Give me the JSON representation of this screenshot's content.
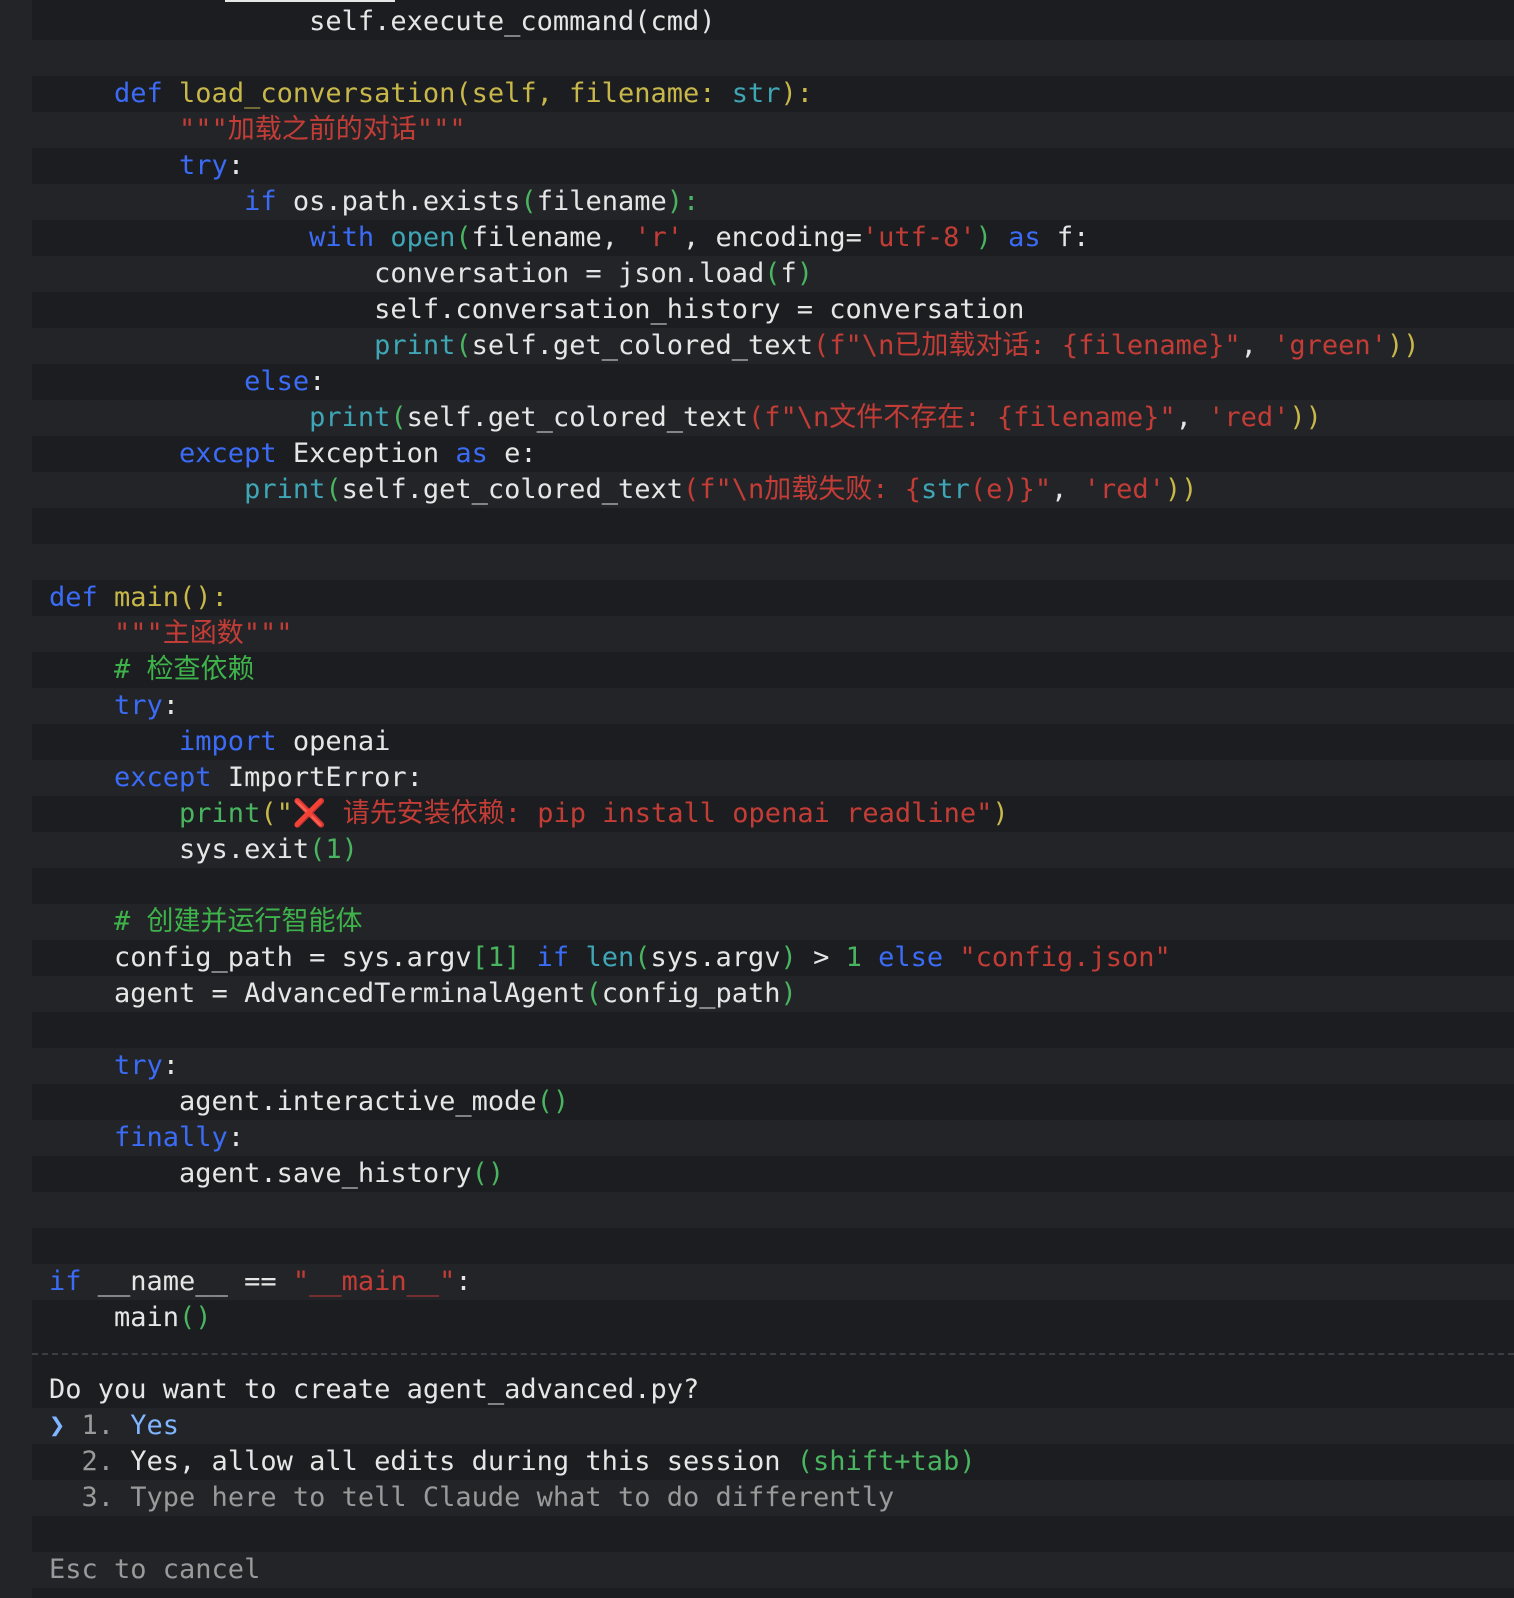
{
  "code": {
    "l01": "                self.execute_command(cmd)",
    "l02": "",
    "l03_kw": "    def ",
    "l03_fn": "load_conversation(self, filename: ",
    "l03_bi": "str",
    "l03_end": "):",
    "l04": "        \"\"\"加载之前的对话\"\"\"",
    "l05_kw": "        try",
    "l05_end": ":",
    "l06_kw": "            if ",
    "l06_tx": "os.path.exists",
    "l06_p1": "(",
    "l06_arg": "filename",
    "l06_p2": "):",
    "l07_kw": "                with ",
    "l07_bi": "open",
    "l07_p1": "(",
    "l07_tx1": "filename, ",
    "l07_st1": "'r'",
    "l07_tx2": ", encoding=",
    "l07_st2": "'utf-8'",
    "l07_p2": ") ",
    "l07_kw2": "as",
    "l07_tx3": " f:",
    "l08_tx": "                    conversation = json.load",
    "l08_p1": "(",
    "l08_a": "f",
    "l08_p2": ")",
    "l09": "                    self.conversation_history = conversation",
    "l10_bi": "                    print",
    "l10_p1": "(",
    "l10_tx": "self.get_colored_text",
    "l10_p2": "(",
    "l10_st": "f\"\\n已加载对话: {filename}\"",
    "l10_c": ", ",
    "l10_st2": "'green'",
    "l10_p3": "))",
    "l11_kw": "            else",
    "l11_end": ":",
    "l12_bi": "                print",
    "l12_p1": "(",
    "l12_tx": "self.get_colored_text",
    "l12_p2": "(",
    "l12_st": "f\"\\n文件不存在: {filename}\"",
    "l12_c": ", ",
    "l12_st2": "'red'",
    "l12_p3": "))",
    "l13_kw": "        except ",
    "l13_tx": "Exception ",
    "l13_kw2": "as",
    "l13_end": " e:",
    "l14_bi": "            print",
    "l14_p1": "(",
    "l14_tx": "self.get_colored_text",
    "l14_p2": "(",
    "l14_st": "f\"\\n加载失败: {",
    "l14_bi2": "str",
    "l14_st3": "(e)}\"",
    "l14_c": ", ",
    "l14_st2": "'red'",
    "l14_p3": "))",
    "l15": "",
    "l16": "",
    "l17_kw": "def ",
    "l17_fn": "main():",
    "l18": "    \"\"\"主函数\"\"\"",
    "l19": "    # 检查依赖",
    "l20_kw": "    try",
    "l20_end": ":",
    "l21_kw": "        import ",
    "l21_tx": "openai",
    "l22_kw": "    except ",
    "l22_tx": "ImportError:",
    "l23_pr": "        print",
    "l23_p1": "(\"",
    "l23_icon": "❌",
    "l23_st": " 请先安装依赖: pip install openai readline\"",
    "l23_p2": ")",
    "l24_tx": "        sys.exit",
    "l24_p1": "(",
    "l24_n": "1",
    "l24_p2": ")",
    "l25": "",
    "l26": "    # 创建并运行智能体",
    "l27_tx": "    config_path = sys.argv",
    "l27_b1": "[1]",
    "l27_kw": " if ",
    "l27_bi": "len",
    "l27_p1": "(",
    "l27_tx2": "sys.argv",
    "l27_p2": ")",
    "l27_tx3": " > ",
    "l27_n": "1",
    "l27_kw2": " else ",
    "l27_st": "\"config.json\"",
    "l28_tx": "    agent = AdvancedTerminalAgent",
    "l28_p1": "(",
    "l28_a": "config_path",
    "l28_p2": ")",
    "l29": "",
    "l30_kw": "    try",
    "l30_end": ":",
    "l31_tx": "        agent.interactive_mode",
    "l31_p": "()",
    "l32_kw": "    finally",
    "l32_end": ":",
    "l33_tx": "        agent.save_history",
    "l33_p": "()",
    "l34": "",
    "l35": "",
    "l36_kw": "if ",
    "l36_tx": "__name__ == ",
    "l36_st": "\"__main__\"",
    "l36_end": ":",
    "l37_tx": "    main",
    "l37_p": "()"
  },
  "prompt": {
    "question": "Do you want to create agent_advanced.py?",
    "cursor": "❯",
    "option1_num": " 1. ",
    "option1_label": "Yes",
    "option2_num": "  2. ",
    "option2_label": "Yes, allow all edits during this session ",
    "option2_hint": "(shift+tab)",
    "option3_num": "  3. ",
    "option3_label": "Type here to tell Claude what to do differently",
    "cancel_hint": "Esc to cancel"
  }
}
